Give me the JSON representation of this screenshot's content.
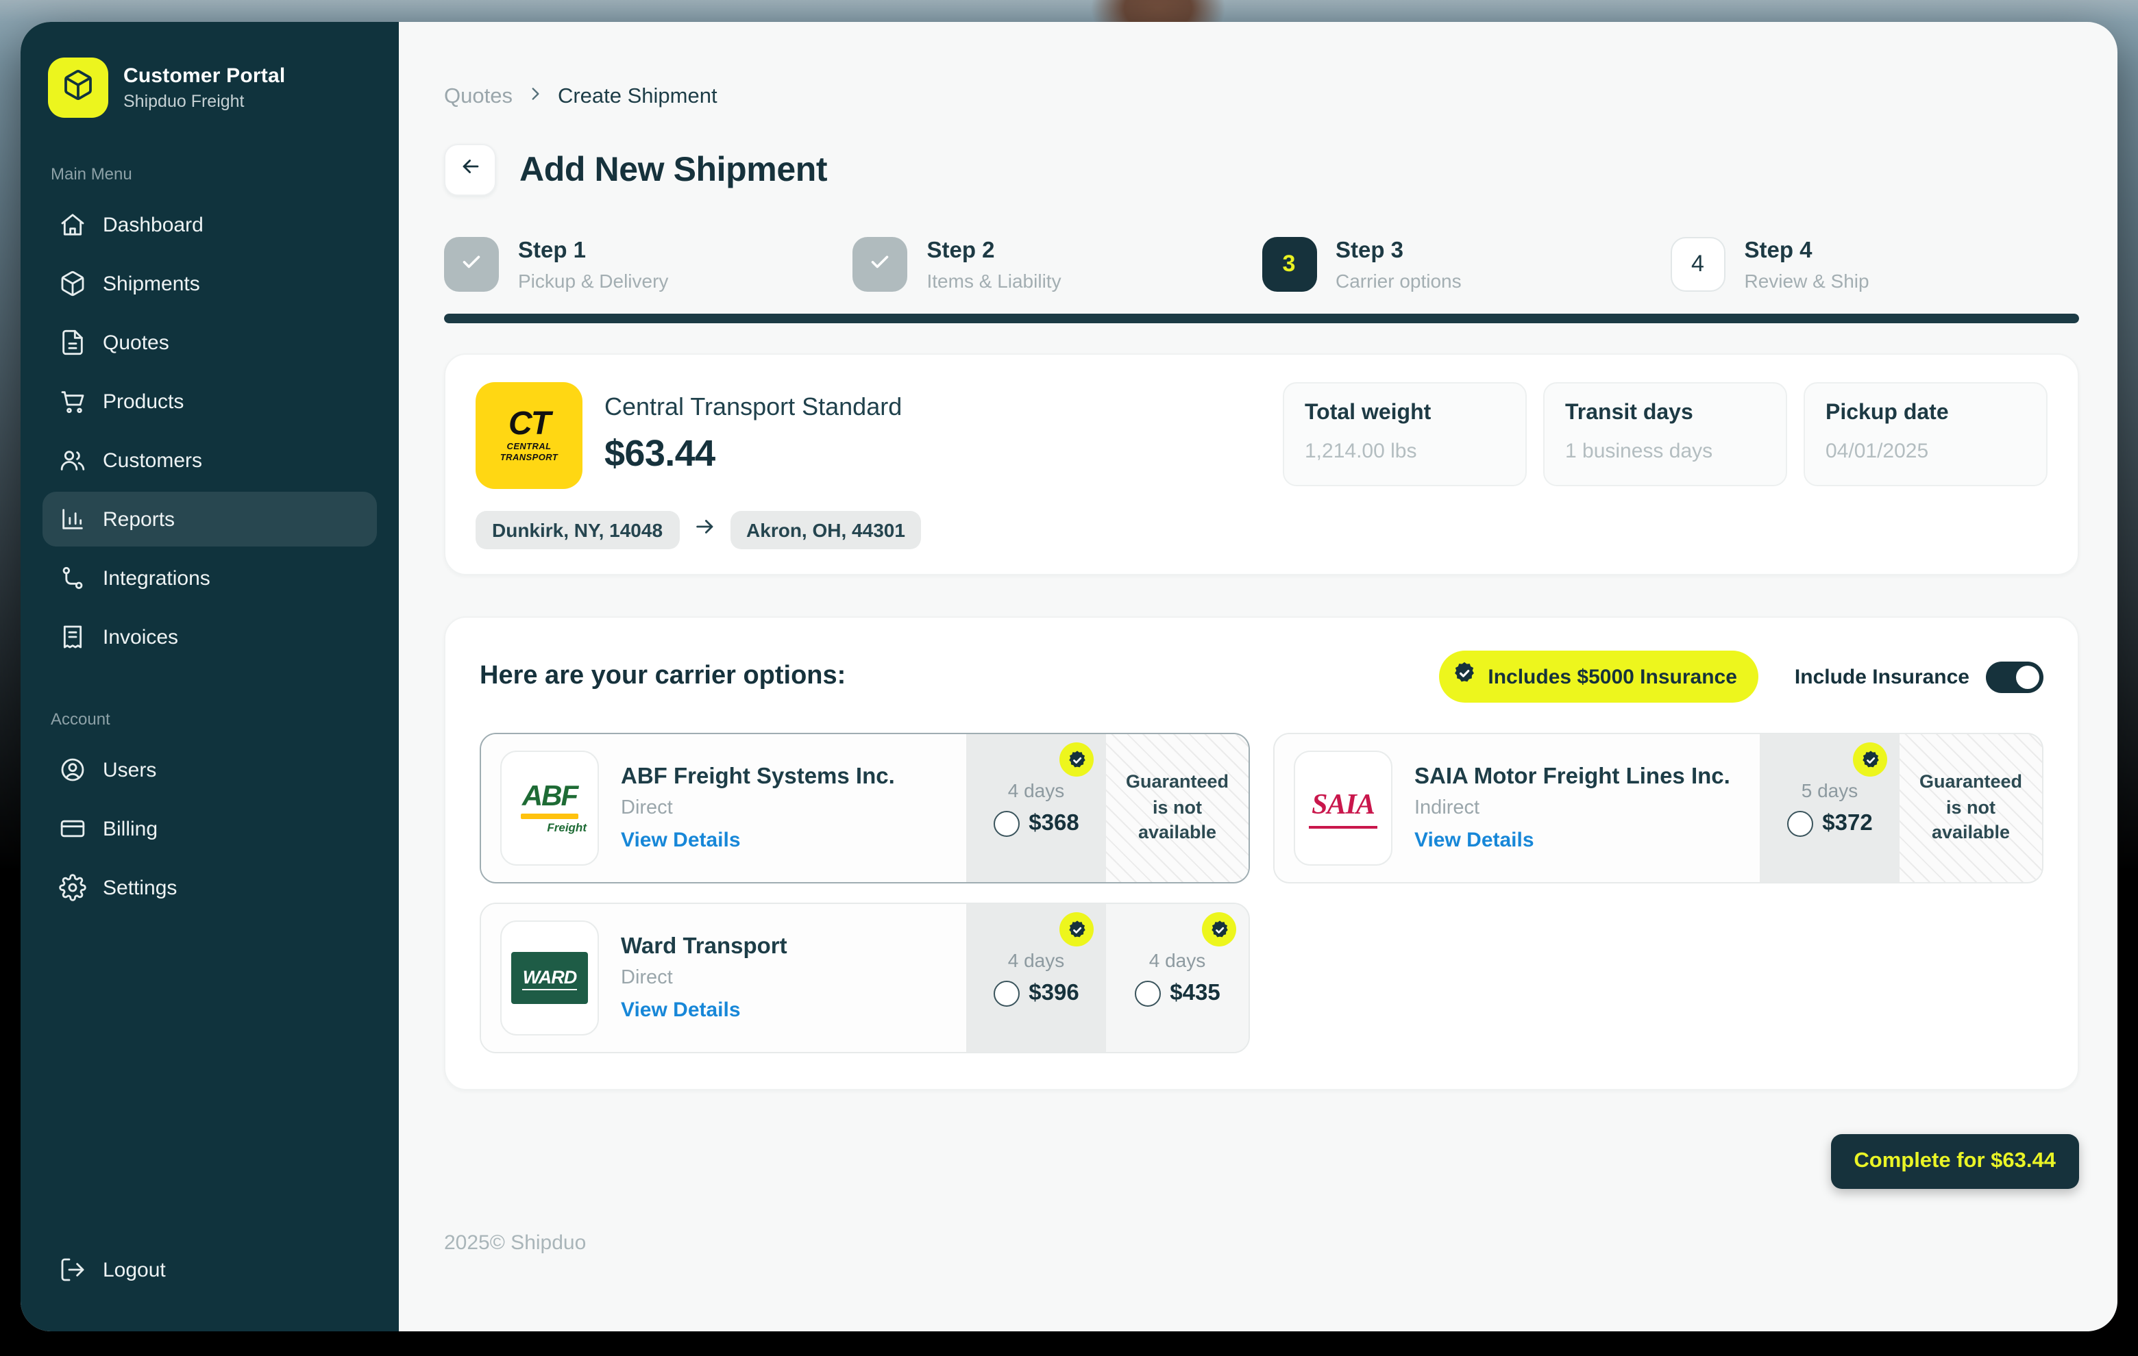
{
  "colors": {
    "brand_yellow": "#ECF51E",
    "sidebar_teal": "#10333D",
    "heading_dark": "#16323C",
    "link_blue": "#1787D8",
    "ct_logo_yellow": "#FFD713",
    "abf_green": "#1E6B35",
    "saia_red": "#C9174C",
    "ward_green": "#1E5C46"
  },
  "sidebar": {
    "brand": {
      "title": "Customer Portal",
      "subtitle": "Shipduo Freight"
    },
    "sections": [
      {
        "label": "Main Menu",
        "items": [
          "Dashboard",
          "Shipments",
          "Quotes",
          "Products",
          "Customers",
          "Reports",
          "Integrations",
          "Invoices"
        ]
      },
      {
        "label": "Account",
        "items": [
          "Users",
          "Billing",
          "Settings"
        ]
      }
    ],
    "active_item": "Reports",
    "logout_label": "Logout"
  },
  "breadcrumb": {
    "parent": "Quotes",
    "current": "Create Shipment"
  },
  "page": {
    "title": "Add New Shipment"
  },
  "stepper": {
    "steps": [
      {
        "title": "Step 1",
        "subtitle": "Pickup & Delivery",
        "status": "done"
      },
      {
        "title": "Step 2",
        "subtitle": "Items & Liability",
        "status": "done"
      },
      {
        "title": "Step 3",
        "subtitle": "Carrier options",
        "status": "current",
        "indicator": "3"
      },
      {
        "title": "Step 4",
        "subtitle": "Review & Ship",
        "status": "upcoming",
        "indicator": "4"
      }
    ],
    "progress_percent": 100
  },
  "summary": {
    "carrier_name": "Central Transport Standard",
    "price": "$63.44",
    "logo": {
      "initials": "CT",
      "line1": "CENTRAL",
      "line2": "TRANSPORT"
    },
    "origin": "Dunkirk, NY, 14048",
    "destination": "Akron, OH, 44301",
    "stats": [
      {
        "label": "Total weight",
        "value": "1,214.00 lbs"
      },
      {
        "label": "Transit days",
        "value": "1 business days"
      },
      {
        "label": "Pickup date",
        "value": "04/01/2025"
      }
    ]
  },
  "carrier_options": {
    "heading": "Here are your carrier options:",
    "insurance_badge": "Includes $5000 Insurance",
    "insurance_toggle": {
      "label": "Include Insurance",
      "on": true
    },
    "cards": [
      {
        "name": "ABF Freight Systems Inc.",
        "service": "Direct",
        "details_label": "View Details",
        "logo": {
          "text": "ABF",
          "sub": "Freight"
        },
        "selected": true,
        "options": [
          {
            "transit": "4 days",
            "price": "$368"
          }
        ],
        "note": "Guaranteed is not available"
      },
      {
        "name": "SAIA Motor Freight Lines Inc.",
        "service": "Indirect",
        "details_label": "View Details",
        "logo": {
          "text": "SAIA"
        },
        "selected": false,
        "options": [
          {
            "transit": "5 days",
            "price": "$372"
          }
        ],
        "note": "Guaranteed is not available"
      },
      {
        "name": "Ward Transport",
        "service": "Direct",
        "details_label": "View Details",
        "logo": {
          "text": "WARD"
        },
        "selected": false,
        "options": [
          {
            "transit": "4 days",
            "price": "$396"
          },
          {
            "transit": "4 days",
            "price": "$435"
          }
        ]
      }
    ]
  },
  "actions": {
    "complete_label": "Complete for $63.44"
  },
  "footer": {
    "copyright": "2025© Shipduo"
  }
}
